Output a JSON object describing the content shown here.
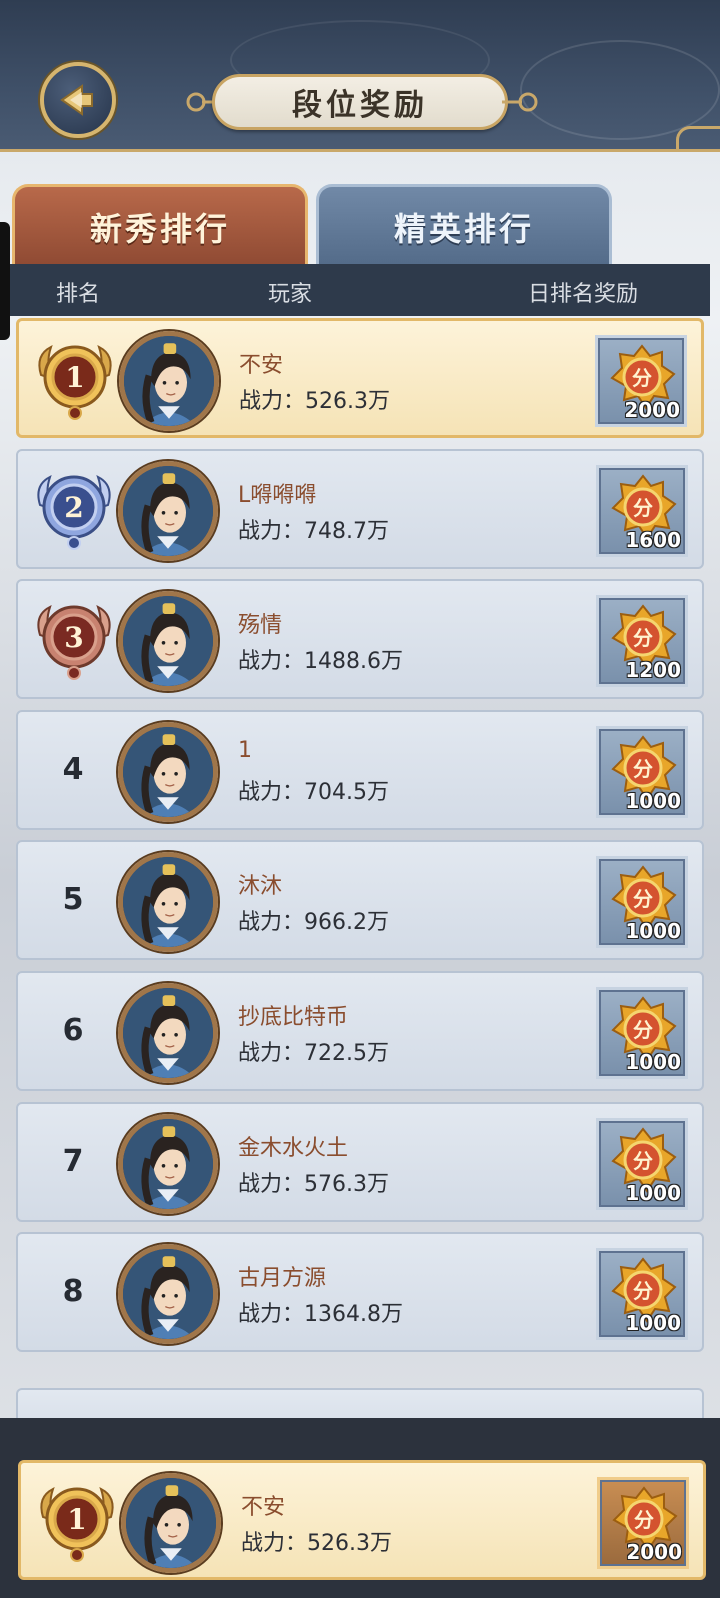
{
  "header": {
    "title": "段位奖励"
  },
  "tabs": [
    {
      "label": "新秀排行",
      "active": true
    },
    {
      "label": "精英排行",
      "active": false
    }
  ],
  "columns": {
    "rank": "排名",
    "player": "玩家",
    "reward": "日排名奖励"
  },
  "power_label": "战力：",
  "reward_icon_char": "分",
  "rankings": [
    {
      "rank": "1",
      "name": "不安",
      "power": "526.3万",
      "reward": "2000",
      "medal": "gold"
    },
    {
      "rank": "2",
      "name": "L嘚嘚嘚",
      "power": "748.7万",
      "reward": "1600",
      "medal": "silver"
    },
    {
      "rank": "3",
      "name": "殇情",
      "power": "1488.6万",
      "reward": "1200",
      "medal": "bronze"
    },
    {
      "rank": "4",
      "name": "1",
      "power": "704.5万",
      "reward": "1000"
    },
    {
      "rank": "5",
      "name": "沐沐",
      "power": "966.2万",
      "reward": "1000"
    },
    {
      "rank": "6",
      "name": "抄底比特币",
      "power": "722.5万",
      "reward": "1000"
    },
    {
      "rank": "7",
      "name": "金木水火土",
      "power": "576.3万",
      "reward": "1000"
    },
    {
      "rank": "8",
      "name": "古月方源",
      "power": "1364.8万",
      "reward": "1000"
    }
  ],
  "my_rank": {
    "rank": "1",
    "name": "不安",
    "power": "526.3万",
    "reward": "2000",
    "medal": "gold"
  },
  "colors": {
    "header_bg": "#3f5068",
    "gold_trim": "#c9a86a",
    "tab_active": "#b8694a",
    "tab_inactive": "#7189a7",
    "name_color": "#8a4d2e"
  }
}
